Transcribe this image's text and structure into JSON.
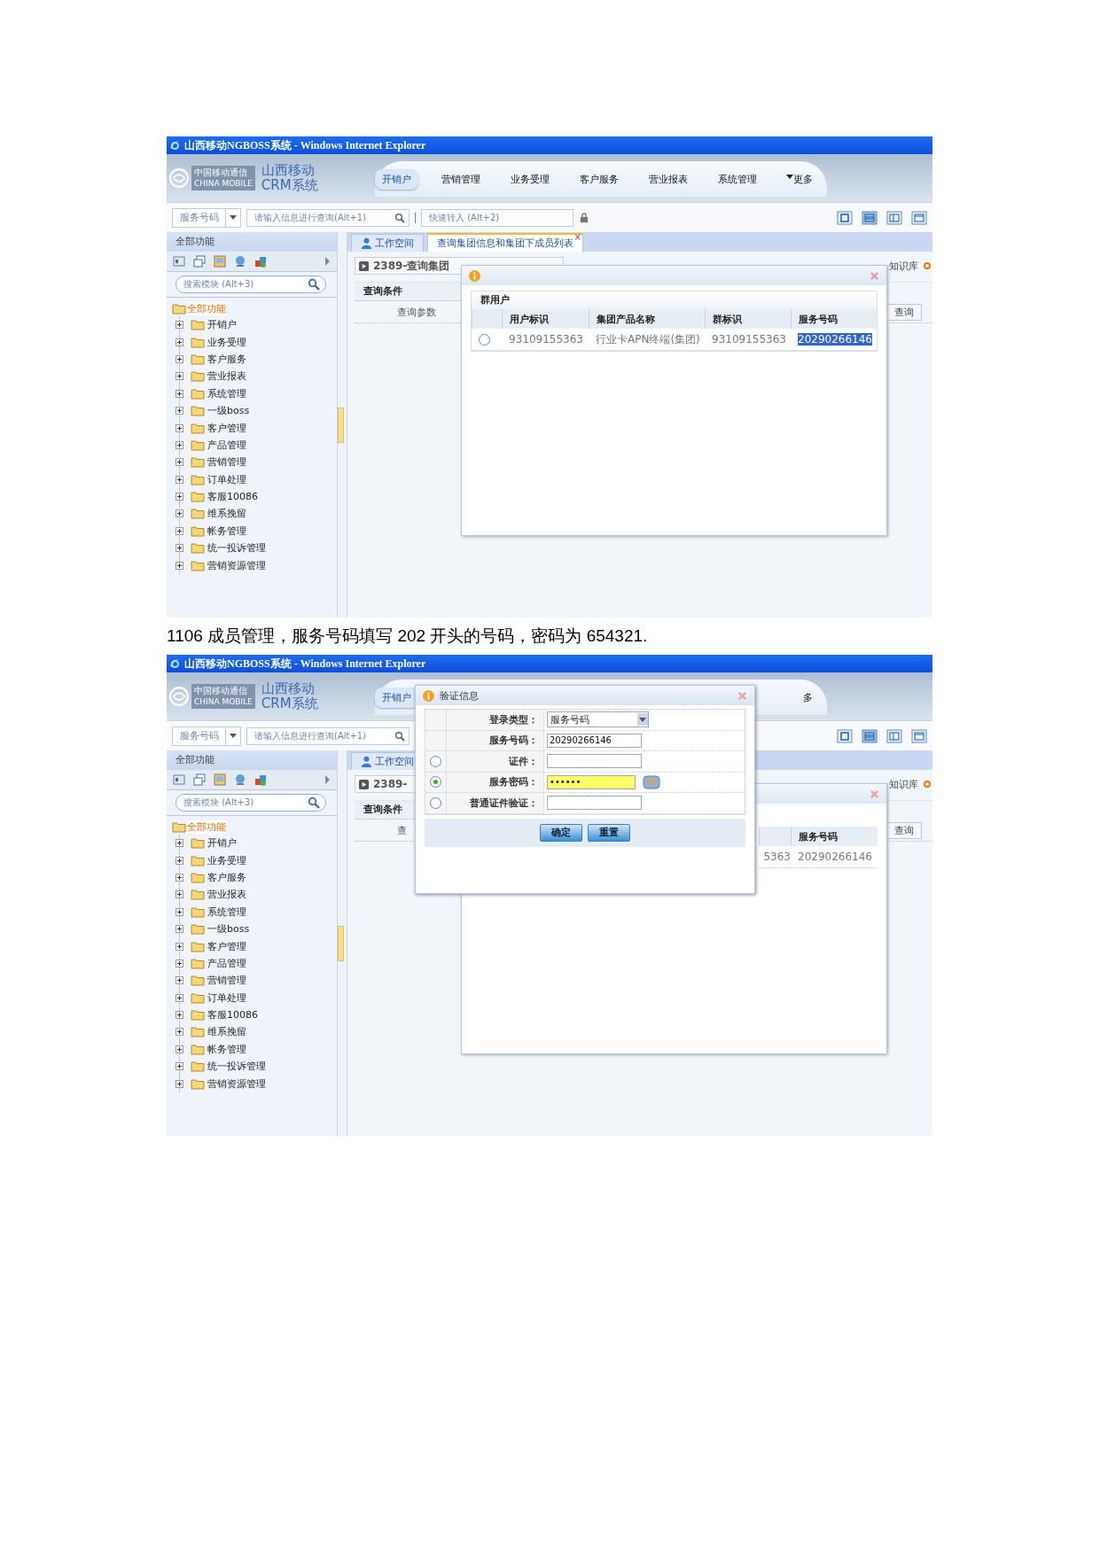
{
  "screenshots": [
    {
      "window_title": "山西移动NGBOSS系统 - Windows Internet Explorer",
      "logo": {
        "company": "中国移动通信",
        "company_en": "CHINA MOBILE",
        "product_1": "山西移动",
        "product_2": "CRM系统"
      },
      "nav": [
        {
          "label": "开销户",
          "selected": true,
          "kind": "item"
        },
        {
          "label": "营销管理",
          "selected": false,
          "kind": "item"
        },
        {
          "label": "业务受理",
          "selected": false,
          "kind": "item"
        },
        {
          "label": "客户服务",
          "selected": false,
          "kind": "item"
        },
        {
          "label": "营业报表",
          "selected": false,
          "kind": "item"
        },
        {
          "label": "系统管理",
          "selected": false,
          "kind": "item"
        },
        {
          "label": "更多",
          "selected": false,
          "kind": "more"
        }
      ],
      "toolbar": {
        "lookup_type": "服务号码",
        "search_placeholder": "请输入信息进行查询(Alt+1)",
        "quick_placeholder": "快速转入 (Alt+2)"
      },
      "sidebar": {
        "title": "全部功能",
        "search_placeholder": "搜索模块 (Alt+3)",
        "tree": {
          "label": "全部功能",
          "children": [
            {
              "label": "开销户",
              "expanded": false
            },
            {
              "label": "业务受理",
              "expanded": false
            },
            {
              "label": "客户服务",
              "expanded": false
            },
            {
              "label": "营业报表",
              "expanded": false
            },
            {
              "label": "系统管理",
              "expanded": false
            },
            {
              "label": "一级boss",
              "expanded": false
            },
            {
              "label": "客户管理",
              "expanded": false
            },
            {
              "label": "产品管理",
              "expanded": false
            },
            {
              "label": "营销管理",
              "expanded": false
            },
            {
              "label": "订单处理",
              "expanded": false
            },
            {
              "label": "客服10086",
              "expanded": false
            },
            {
              "label": "维系挽留",
              "expanded": false
            },
            {
              "label": "帐务管理",
              "expanded": false
            },
            {
              "label": "统一投诉管理",
              "expanded": false
            },
            {
              "label": "营销资源管理",
              "expanded": false
            }
          ]
        }
      },
      "tabs": [
        {
          "label": "工作空间",
          "selected": false,
          "kind": "home"
        },
        {
          "label": "查询集团信息和集团下成员列表",
          "selected": true,
          "kind": "page",
          "close": "×"
        }
      ],
      "page_title": "2389-查询集团",
      "knowledge": "知识库",
      "query": {
        "title": "查询条件",
        "param_label": "查询参数",
        "button": "查询"
      },
      "group_dialog": {
        "kind": "full",
        "group": "群用户",
        "columns": [
          "用户标识",
          "集团产品名称",
          "群标识",
          "服务号码"
        ],
        "rows": [
          {
            "selected": false,
            "cells": [
              {
                "text": "93109155363",
                "highlighted": false
              },
              {
                "text": "行业卡APN终端(集团)",
                "highlighted": false
              },
              {
                "text": "93109155363",
                "highlighted": false
              },
              {
                "text": "20290266146",
                "highlighted": true
              }
            ]
          }
        ]
      }
    },
    {
      "window_title": "山西移动NGBOSS系统 - Windows Internet Explorer",
      "logo": {
        "company": "中国移动通信",
        "company_en": "CHINA MOBILE",
        "product_1": "山西移动",
        "product_2": "CRM系统"
      },
      "nav": [
        {
          "label": "开销户",
          "selected": true,
          "kind": "item"
        },
        {
          "label": "多",
          "selected": false,
          "kind": "cut"
        }
      ],
      "toolbar": {
        "lookup_type": "服务号码",
        "search_placeholder": "请输入信息进行查询(Alt+1)"
      },
      "sidebar": {
        "title": "全部功能",
        "search_placeholder": "搜索模块 (Alt+3)",
        "tree": {
          "label": "全部功能",
          "children": [
            {
              "label": "开销户",
              "expanded": false
            },
            {
              "label": "业务受理",
              "expanded": false
            },
            {
              "label": "客户服务",
              "expanded": false
            },
            {
              "label": "营业报表",
              "expanded": false
            },
            {
              "label": "系统管理",
              "expanded": false
            },
            {
              "label": "一级boss",
              "expanded": false
            },
            {
              "label": "客户管理",
              "expanded": false
            },
            {
              "label": "产品管理",
              "expanded": false
            },
            {
              "label": "营销管理",
              "expanded": false
            },
            {
              "label": "订单处理",
              "expanded": false
            },
            {
              "label": "客服10086",
              "expanded": false
            },
            {
              "label": "维系挽留",
              "expanded": false
            },
            {
              "label": "帐务管理",
              "expanded": false
            },
            {
              "label": "统一投诉管理",
              "expanded": false
            },
            {
              "label": "营销资源管理",
              "expanded": false
            }
          ]
        }
      },
      "tabs": [
        {
          "label": "工作空间",
          "selected": false,
          "kind": "home"
        }
      ],
      "page_title": "2389-",
      "knowledge": "知识库",
      "query": {
        "title": "查询条件",
        "param_label": "查",
        "button": "查询"
      },
      "group_dialog": {
        "kind": "partial",
        "columns": [
          "",
          "服务号码"
        ],
        "rows": [
          {
            "cells": [
              {
                "text": "5363",
                "highlighted": false
              },
              {
                "text": "20290266146",
                "highlighted": false
              }
            ]
          }
        ]
      },
      "verify_dialog": {
        "title": "验证信息",
        "rows": [
          {
            "kind": "select",
            "label": "登录类型：",
            "value": "服务号码"
          },
          {
            "kind": "text",
            "label": "服务号码：",
            "value": "20290266146"
          },
          {
            "kind": "radio_text",
            "label": "证件：",
            "selected": false
          },
          {
            "kind": "radio_password",
            "label": "服务密码：",
            "selected": true,
            "value": "••••••"
          },
          {
            "kind": "radio_text",
            "label": "普通证件验证：",
            "selected": false
          }
        ],
        "buttons": [
          "确定",
          "重置"
        ]
      }
    }
  ],
  "caption": "1106 成员管理，服务号码填写 202 开头的号码，密码为 654321."
}
